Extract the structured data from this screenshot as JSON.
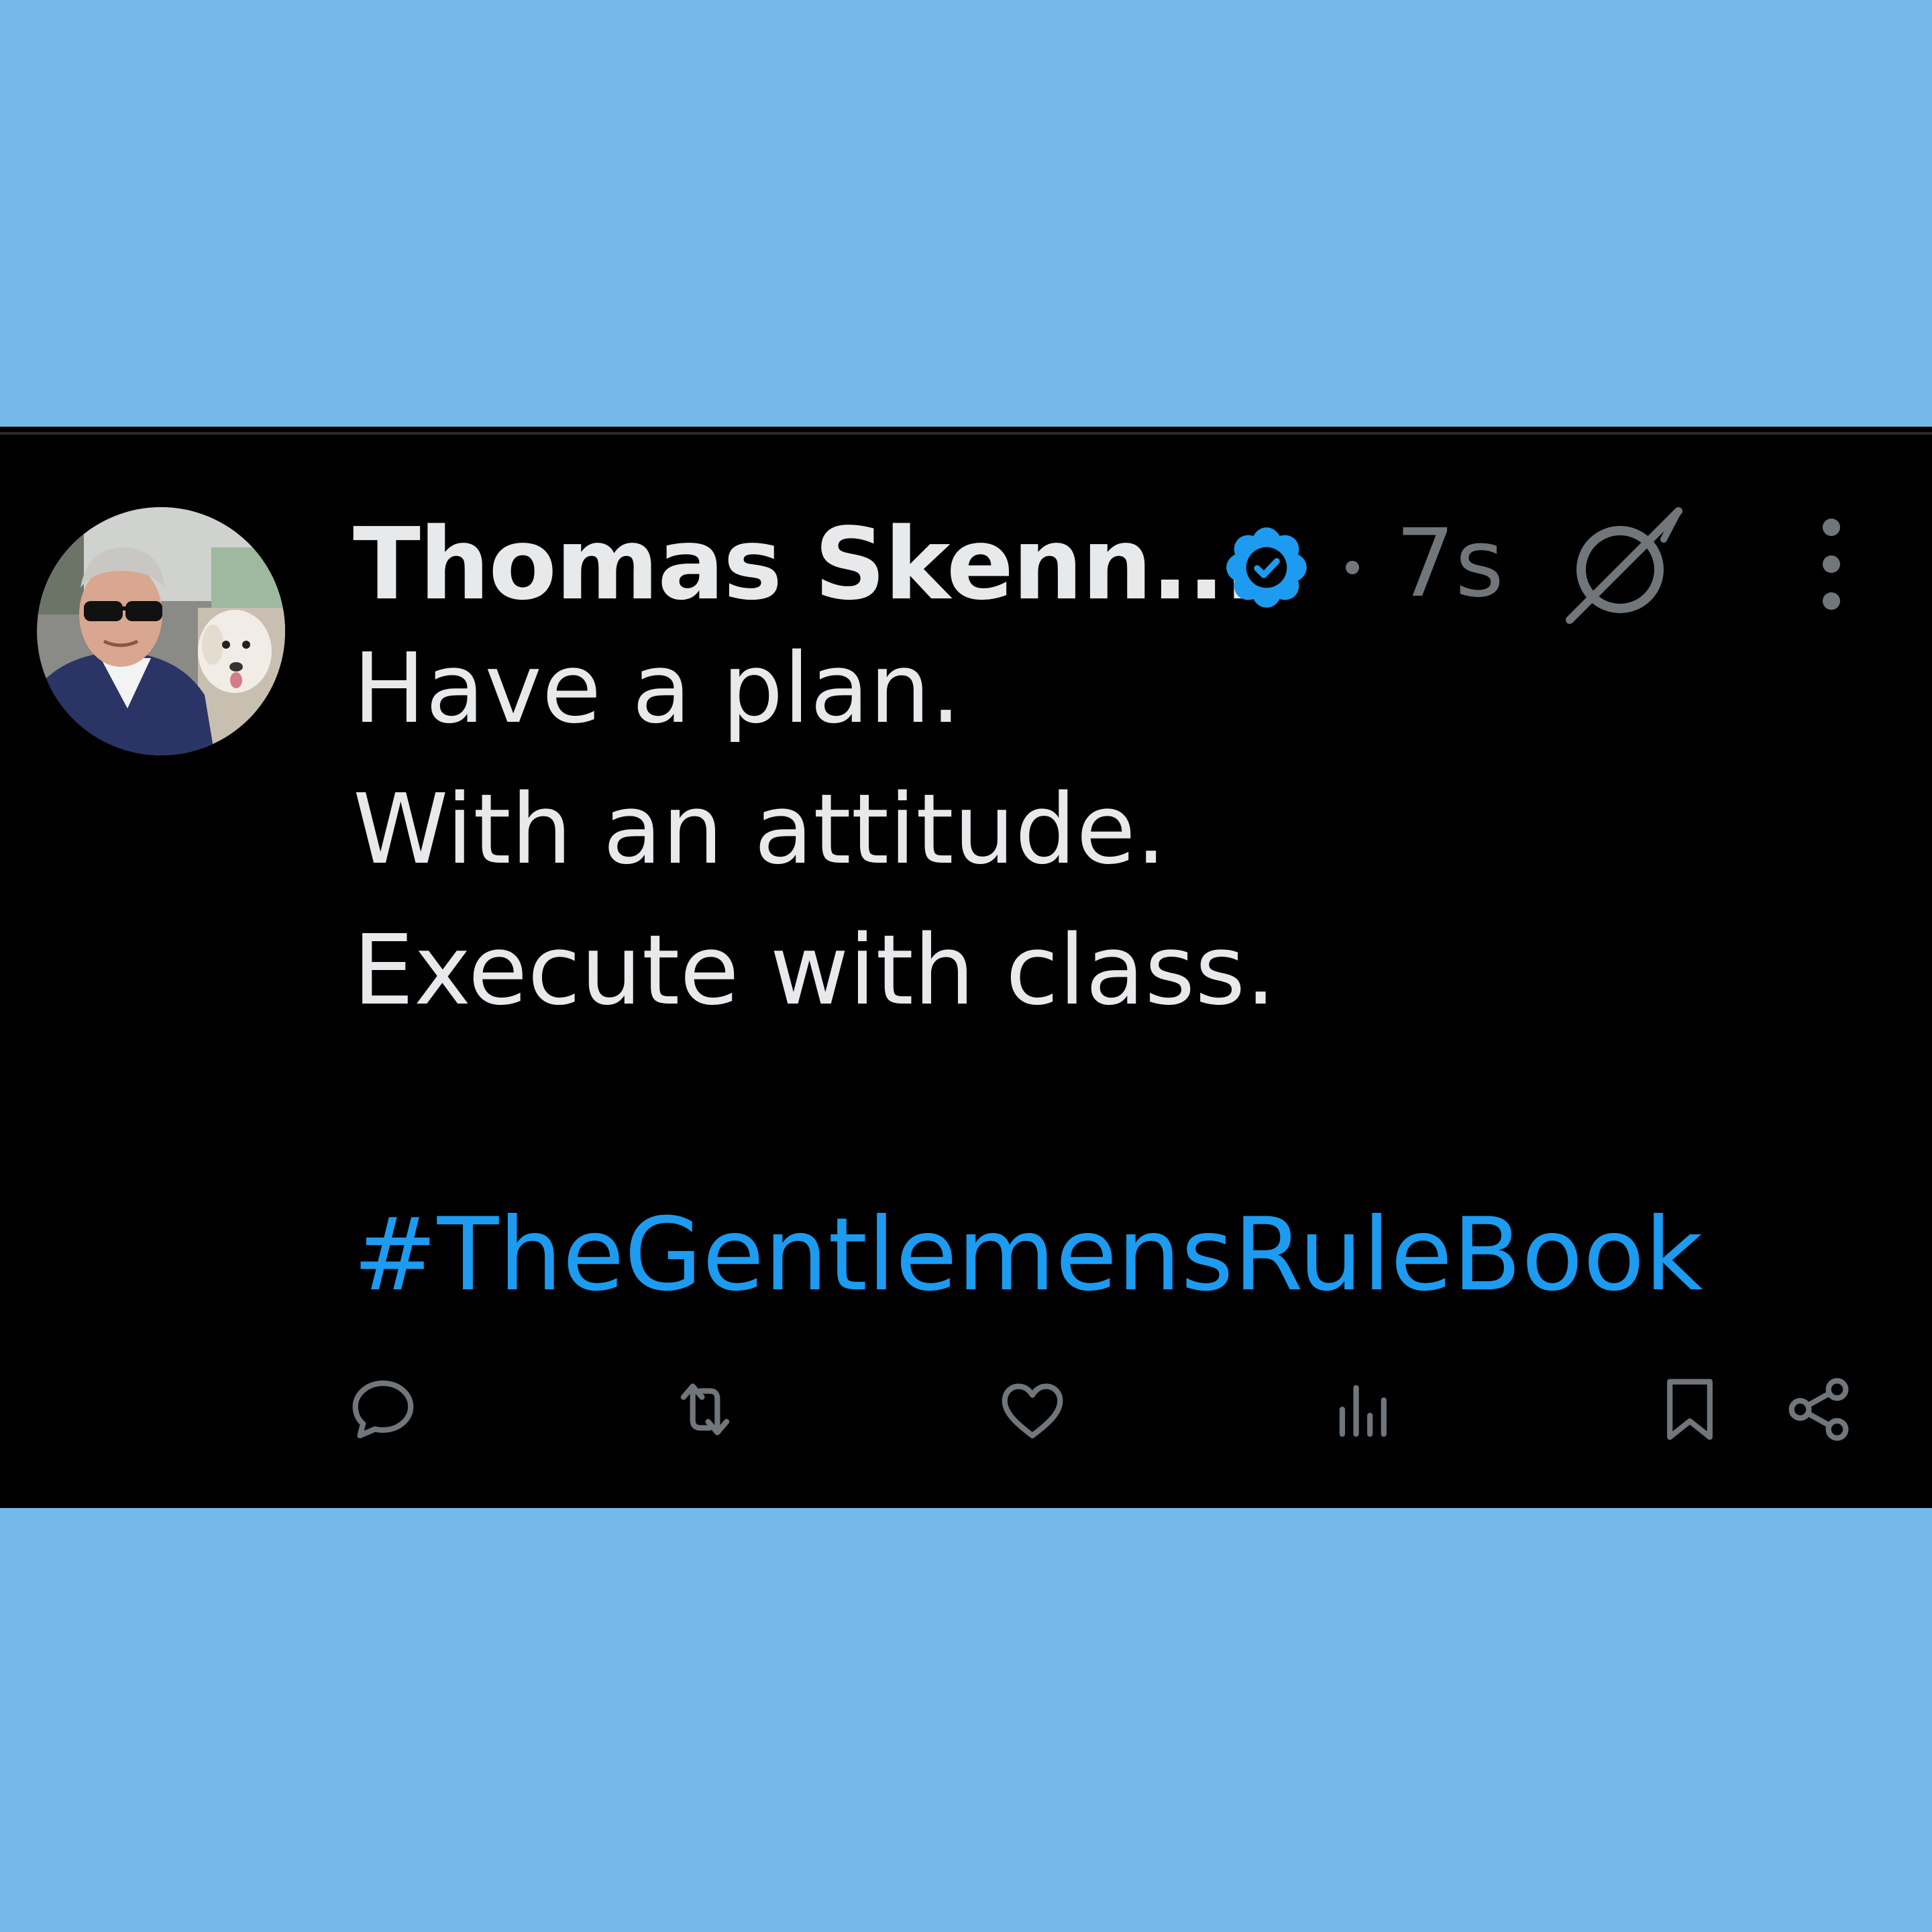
{
  "post": {
    "author_name": "Thomas Skenn...",
    "timestamp": "7s",
    "lines": [
      "Have a plan.",
      "With an attitude.",
      "Execute with class."
    ],
    "hashtag": "#TheGentlemensRuleBook"
  },
  "icons": {
    "verified": "verified-badge-icon",
    "grok": "grok-icon",
    "more": "more-vertical-icon",
    "reply": "reply-icon",
    "repost": "repost-icon",
    "like": "like-icon",
    "views": "views-icon",
    "bookmark": "bookmark-icon",
    "share": "share-icon"
  },
  "colors": {
    "page_background": "#75B9EB",
    "card_background": "#000000",
    "primary_text": "#E7E9EA",
    "secondary_text": "#71767B",
    "accent": "#1D9BF0"
  }
}
